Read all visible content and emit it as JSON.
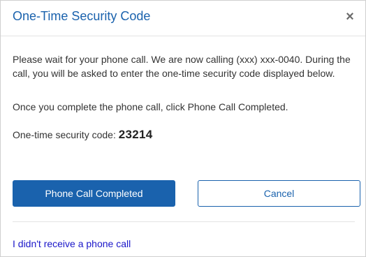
{
  "dialog": {
    "title": "One-Time Security Code",
    "close_glyph": "×",
    "close_icon": "close-icon",
    "message": "Please wait for your phone call. We are now calling (xxx) xxx-0040. During the call, you will be asked to enter the one-time security code displayed below.",
    "instruction": "Once you complete the phone call, click Phone Call Completed.",
    "code_label": "One-time security code:",
    "code_value": "23214",
    "primary_button": "Phone Call Completed",
    "secondary_button": "Cancel",
    "help_link": "I didn't receive a phone call"
  },
  "colors": {
    "brand_blue": "#1a62ad",
    "link_blue": "#1a16c9",
    "text": "#333333"
  }
}
